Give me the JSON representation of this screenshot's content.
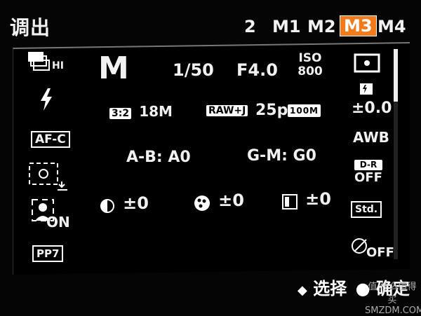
{
  "header": {
    "title": "调出",
    "slots": [
      "2",
      "M1",
      "M2",
      "M3",
      "M4"
    ],
    "active_slot": "M3"
  },
  "left_col": {
    "drive": "HI",
    "af_mode": "AF-C",
    "face": "ON",
    "picture_profile": "PP7"
  },
  "main": {
    "mode": "M",
    "shutter": "1/50",
    "aperture": "F4.0",
    "iso_label": "ISO",
    "iso_value": "800",
    "aspect": "3:2",
    "size": "18M",
    "quality": "RAW+J",
    "movie_fps": "25p",
    "movie_bitrate": "100M",
    "wb_ab": "A-B: A0",
    "wb_gm": "G-M: G0",
    "contrast": "±0",
    "saturation": "±0",
    "sharpness": "±0"
  },
  "right_col": {
    "exposure_comp": "±0.0",
    "wb": "AWB",
    "dro_label": "D-R",
    "dro_value": "OFF",
    "creative_style": "Std.",
    "picture_effect": "OFF"
  },
  "footer": {
    "select": "选择",
    "confirm": "确定",
    "watermark_cn": "值 什么值得买",
    "watermark_en": "SMZDM.COM"
  },
  "colors": {
    "accent": "#f37a1b",
    "background": "#000000",
    "text": "#f2f2f2"
  }
}
